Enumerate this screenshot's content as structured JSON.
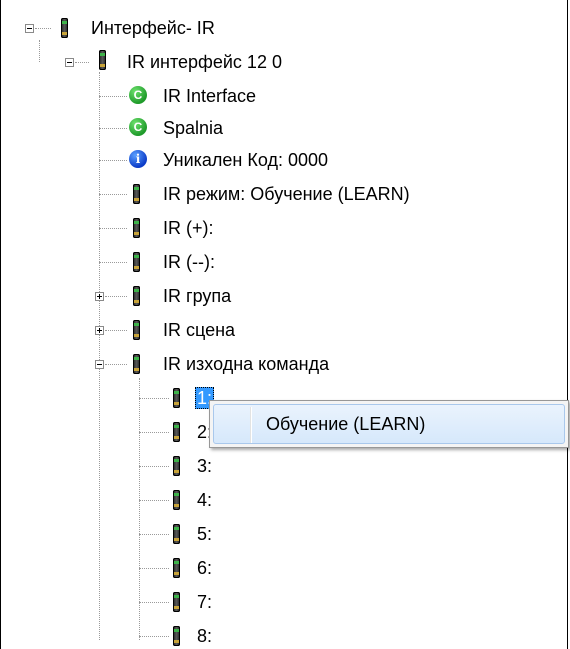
{
  "tree": {
    "root_label": "Интерфейс- IR",
    "module_label": "IR интерфейс 12 0",
    "items": {
      "ir_interface": "IR Interface",
      "spalnia": "Spalnia",
      "unique_code": "Уникален Код: 0000",
      "ir_mode": "IR режим: Обучение (LEARN)",
      "ir_plus": "IR (+):",
      "ir_minus": "IR (--):",
      "ir_group": "IR група",
      "ir_scene": "IR сцена",
      "ir_output_command": "IR изходна команда"
    },
    "commands": [
      "1:",
      "2:",
      "3:",
      "4:",
      "5:",
      "6:",
      "7:",
      "8:"
    ],
    "icons": {
      "green_badge_letter": "C",
      "info_badge_letter": "i"
    }
  },
  "context_menu": {
    "item_label": "Обучение (LEARN)"
  },
  "colors": {
    "selection": "#3399ff",
    "green_badge": "#1f9a2a",
    "info_badge": "#0c3cc8"
  }
}
